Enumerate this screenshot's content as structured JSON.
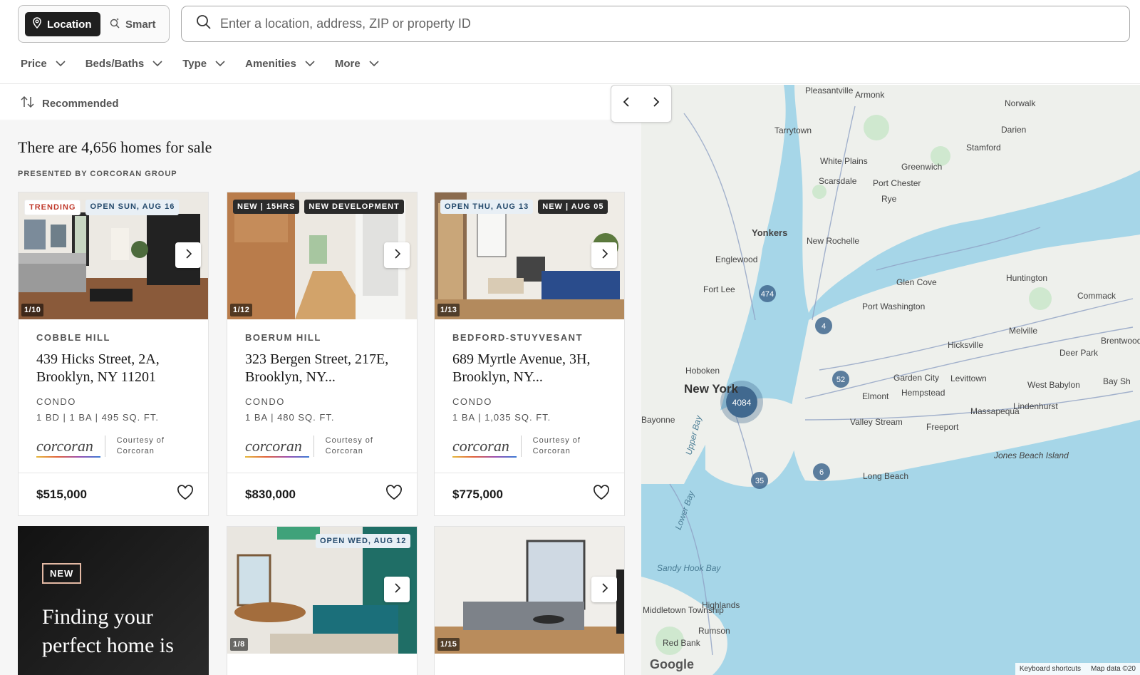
{
  "search": {
    "mode_location": "Location",
    "mode_smart": "Smart",
    "placeholder": "Enter a location, address, ZIP or property ID"
  },
  "filters": [
    "Price",
    "Beds/Baths",
    "Type",
    "Amenities",
    "More"
  ],
  "sort": {
    "label": "Recommended"
  },
  "results": {
    "count_text": "There are 4,656 homes for sale",
    "presented_by": "PRESENTED BY CORCORAN GROUP"
  },
  "listings": [
    {
      "badges": [
        "TRENDING",
        "OPEN SUN, AUG 16"
      ],
      "photo_counter": "1/10",
      "neighborhood": "COBBLE HILL",
      "address": "439 Hicks Street, 2A, Brooklyn, NY 11201",
      "type": "CONDO",
      "specs": "1 BD | 1 BA | 495 SQ. FT.",
      "brand": "corcoran",
      "courtesy": "Courtesy of Corcoran",
      "price": "$515,000"
    },
    {
      "badges": [
        "NEW | 15HRS",
        "NEW DEVELOPMENT"
      ],
      "photo_counter": "1/12",
      "neighborhood": "BOERUM HILL",
      "address": "323 Bergen Street, 217E, Brooklyn, NY...",
      "type": "CONDO",
      "specs": "1 BA | 480 SQ. FT.",
      "brand": "corcoran",
      "courtesy": "Courtesy of Corcoran",
      "price": "$830,000"
    },
    {
      "badges": [
        "OPEN THU, AUG 13",
        "NEW | AUG 05"
      ],
      "photo_counter": "1/13",
      "neighborhood": "BEDFORD-STUYVESANT",
      "address": "689 Myrtle Avenue, 3H, Brooklyn, NY...",
      "type": "CONDO",
      "specs": "1 BA | 1,035 SQ. FT.",
      "brand": "corcoran",
      "courtesy": "Courtesy of Corcoran",
      "price": "$775,000"
    }
  ],
  "second_row": [
    {
      "badges": [
        "OPEN WED, AUG 12"
      ],
      "photo_counter": "1/8"
    },
    {
      "badges": [],
      "photo_counter": "1/15"
    }
  ],
  "promo": {
    "tag": "NEW",
    "headline": "Finding your perfect home is"
  },
  "map": {
    "cluster_main": "4084",
    "clusters": [
      "474",
      "4",
      "52",
      "6",
      "35"
    ],
    "places": [
      "Pleasantville",
      "Armonk",
      "Norwalk",
      "Darien",
      "Stamford",
      "Tarrytown",
      "White Plains",
      "Greenwich",
      "Scarsdale",
      "Port Chester",
      "Rye",
      "Yonkers",
      "New Rochelle",
      "Englewood",
      "Fort Lee",
      "Glen Cove",
      "Huntington",
      "Commack",
      "Port Washington",
      "Melville",
      "Hicksville",
      "Deer Park",
      "Hoboken",
      "New York",
      "Garden City",
      "Levittown",
      "West Babylon",
      "Elmont",
      "Hempstead",
      "Lindenhurst",
      "Bayonne",
      "Valley Stream",
      "Freeport",
      "Massapequa",
      "Jones Beach Island",
      "Long Beach",
      "Sandy Hook Bay",
      "Middletown Township",
      "Highlands",
      "Rumson",
      "Red Bank",
      "Upper Bay",
      "Lower Bay",
      "Brentwood",
      "Bay Sh"
    ],
    "keyboard_shortcuts": "Keyboard shortcuts",
    "map_data": "Map data ©20",
    "google": "Google"
  },
  "colors": {
    "accent_dark": "#1f1f1f",
    "badge_light": "#e8eff5",
    "water": "#a6d6e8",
    "land": "#f1f3f4",
    "cluster": "#41698f"
  }
}
